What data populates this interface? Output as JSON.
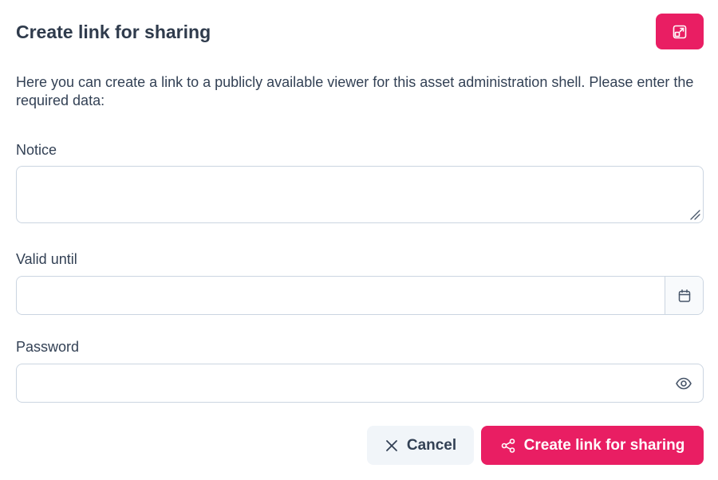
{
  "dialog": {
    "title": "Create link for sharing",
    "intro": "Here you can create a link to a publicly available viewer for this asset administration shell. Please enter the required data:"
  },
  "form": {
    "notice": {
      "label": "Notice",
      "value": ""
    },
    "valid_until": {
      "label": "Valid until",
      "value": ""
    },
    "password": {
      "label": "Password",
      "value": ""
    }
  },
  "actions": {
    "cancel_label": "Cancel",
    "create_label": "Create link for sharing"
  },
  "icons": {
    "expand": "expand-icon",
    "calendar": "calendar-icon",
    "eye": "eye-icon",
    "close": "close-icon",
    "share": "share-icon"
  },
  "colors": {
    "accent": "#e91e63",
    "text": "#334155",
    "border": "#cbd5e1",
    "cancel_bg": "#f1f5f9"
  }
}
